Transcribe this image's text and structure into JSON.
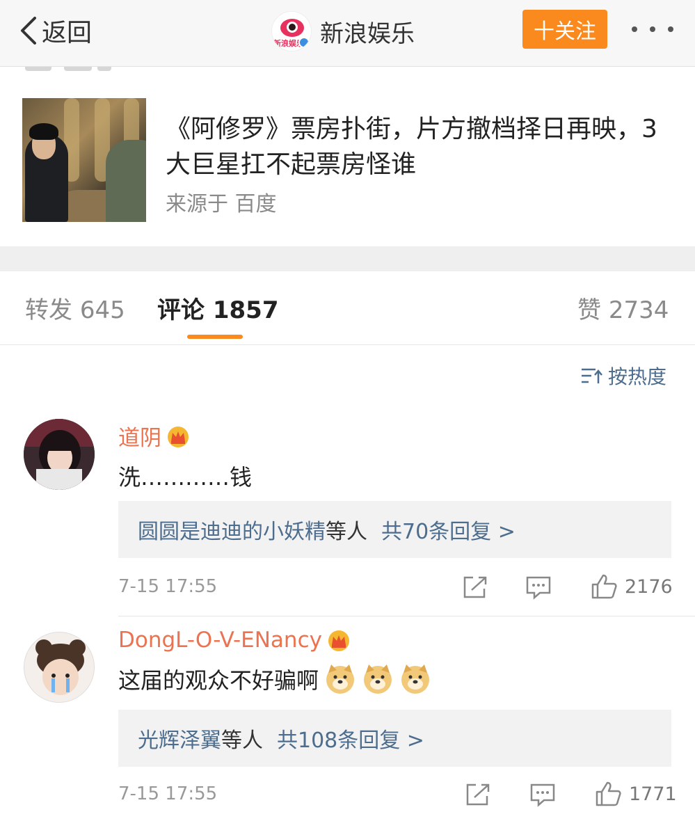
{
  "nav": {
    "back_label": "返回",
    "account_name": "新浪娱乐",
    "logo_text": "新浪娱乐",
    "follow_label": "十关注",
    "more_icon": "more-dots-icon"
  },
  "article": {
    "title": "《阿修罗》票房扑街，片方撤档择日再映，3大巨星扛不起票房怪谁",
    "source": "来源于 百度"
  },
  "tabs": {
    "repost_label": "转发",
    "repost_count": "645",
    "comment_label": "评论",
    "comment_count": "1857",
    "like_label": "赞",
    "like_count": "2734"
  },
  "sort": {
    "label": "按热度"
  },
  "comments": [
    {
      "username": "道阴",
      "text": "洗…………钱",
      "reply_who": "圆圆是迪迪的小妖精",
      "reply_tail": "等人",
      "reply_count": "共70条回复 >",
      "time": "7-15 17:55",
      "likes": "2176"
    },
    {
      "username": "DongL-O-V-ENancy",
      "text": "这届的观众不好骗啊",
      "reply_who": "光辉泽翼",
      "reply_tail": "等人",
      "reply_count": "共108条回复 >",
      "time": "7-15 17:55",
      "likes": "1771"
    }
  ],
  "colors": {
    "accent_orange": "#fa8a1e",
    "username_orange": "#eb7350",
    "link_blue": "#4d6d8e"
  }
}
